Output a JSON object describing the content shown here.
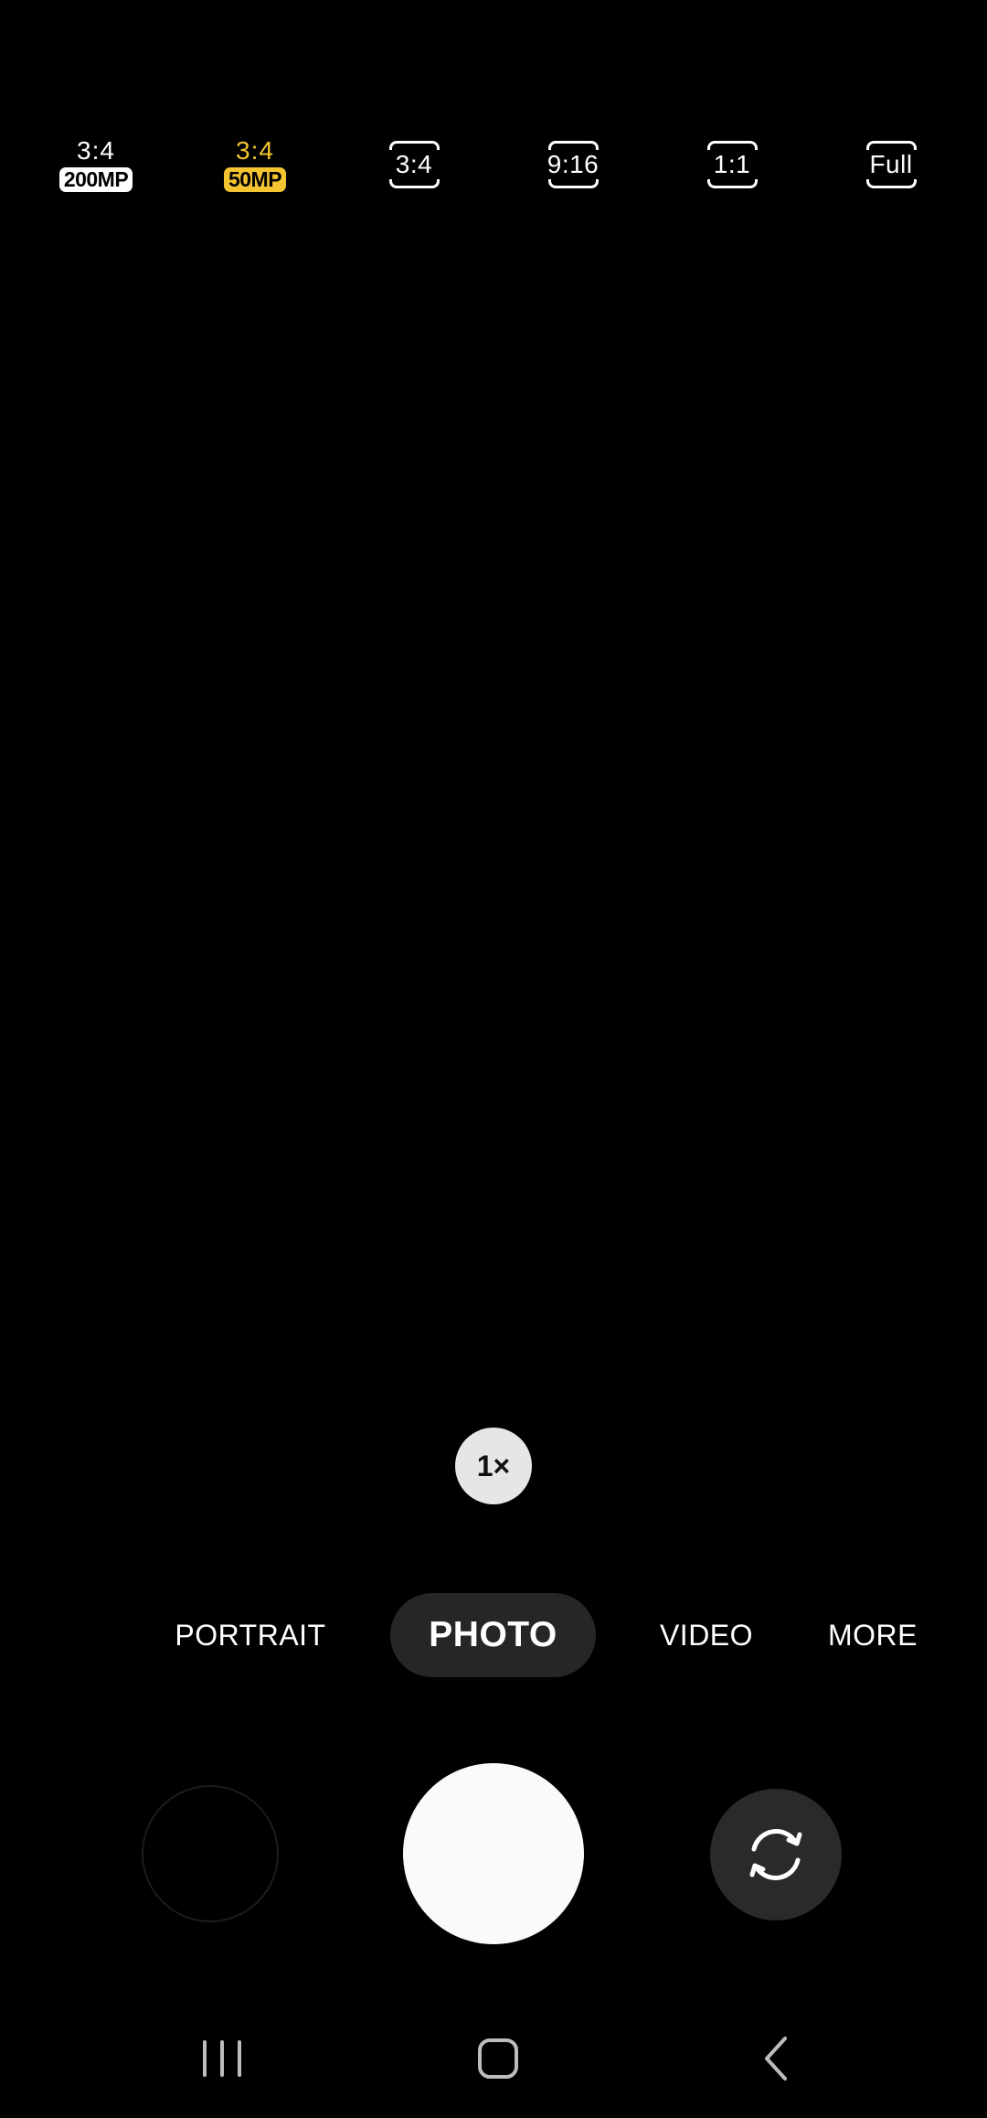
{
  "aspect_ratio_bar": {
    "options": [
      {
        "label": "3:4",
        "badge": "200MP",
        "style": "badge",
        "selected": false
      },
      {
        "label": "3:4",
        "badge": "50MP",
        "style": "badge",
        "selected": true
      },
      {
        "label": "3:4",
        "style": "frame",
        "selected": false
      },
      {
        "label": "9:16",
        "style": "frame",
        "selected": false
      },
      {
        "label": "1:1",
        "style": "frame",
        "selected": false
      },
      {
        "label": "Full",
        "style": "frame",
        "selected": false
      }
    ]
  },
  "zoom": {
    "label": "1×"
  },
  "modes": {
    "items": [
      {
        "label": "PORTRAIT",
        "selected": false
      },
      {
        "label": "PHOTO",
        "selected": true
      },
      {
        "label": "VIDEO",
        "selected": false
      },
      {
        "label": "MORE",
        "selected": false
      }
    ]
  },
  "controls": {
    "gallery_icon": "gallery-thumbnail-icon",
    "shutter_icon": "shutter-icon",
    "switch_icon": "switch-camera-icon"
  },
  "nav": {
    "recents_icon": "recents-icon",
    "home_icon": "home-icon",
    "back_icon": "back-icon"
  },
  "colors": {
    "accent": "#f5c531",
    "background": "#000000",
    "selected_mode_bg": "#262626",
    "shutter": "#fafafa",
    "zoom_bg": "#e6e6e6"
  }
}
